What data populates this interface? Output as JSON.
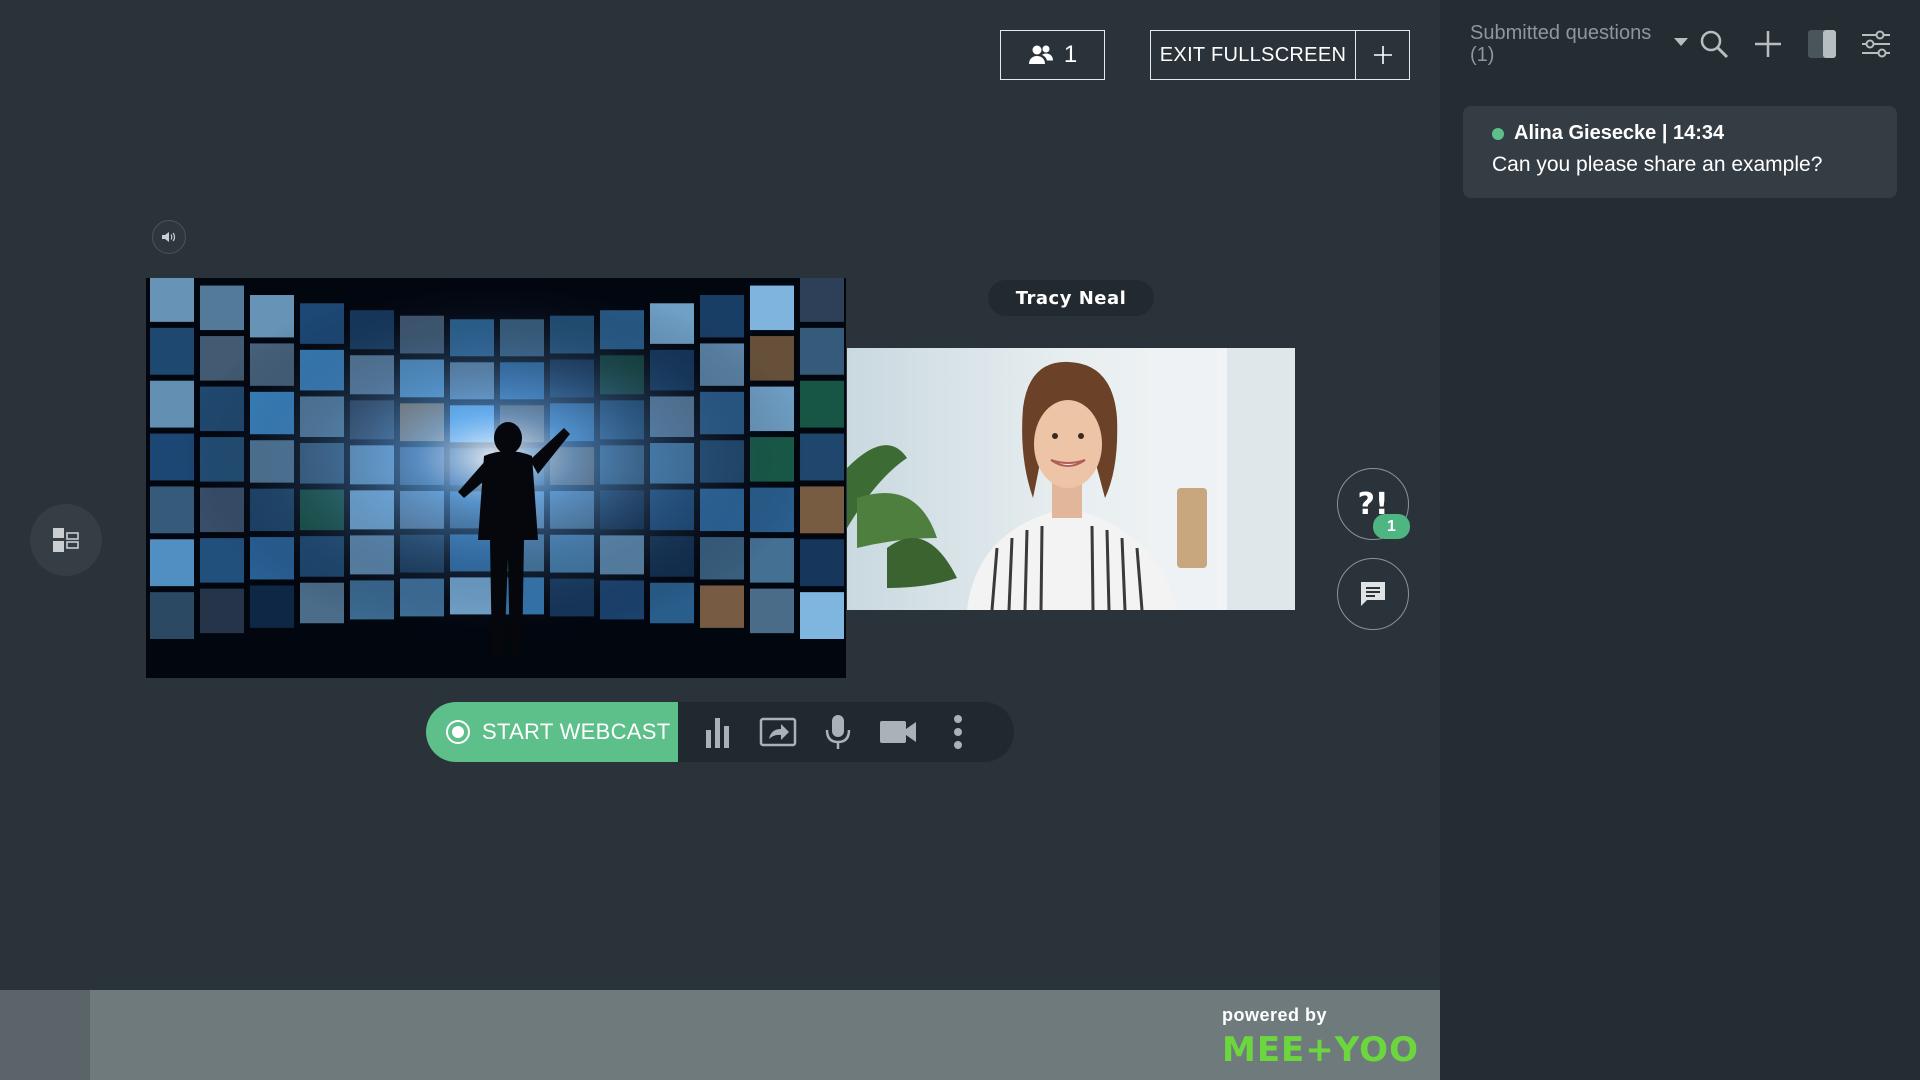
{
  "header": {
    "participant_count": "1",
    "exit_fullscreen_label": "EXIT FULLSCREEN"
  },
  "stage": {
    "camera_tile_name": "Tracy Neal",
    "qa_badge_count": "1",
    "qa_icon_text": "?!"
  },
  "toolbar": {
    "start_webcast_label": "START WEBCAST",
    "tools": [
      "poll-icon",
      "share-screen-icon",
      "microphone-icon",
      "camera-icon",
      "more-vertical-icon"
    ]
  },
  "footer": {
    "powered_by": "powered by",
    "brand": "MEE+YOO"
  },
  "sidebar": {
    "title": "Submitted questions (1)",
    "questions": [
      {
        "author_time": "Alina Giesecke | 14:34",
        "text": "Can you please share an example?"
      }
    ]
  },
  "colors": {
    "accent_green": "#5dbf8a",
    "brand_green": "#6bd63d",
    "background": "#2b333a",
    "sidebar_background": "#252c32"
  }
}
